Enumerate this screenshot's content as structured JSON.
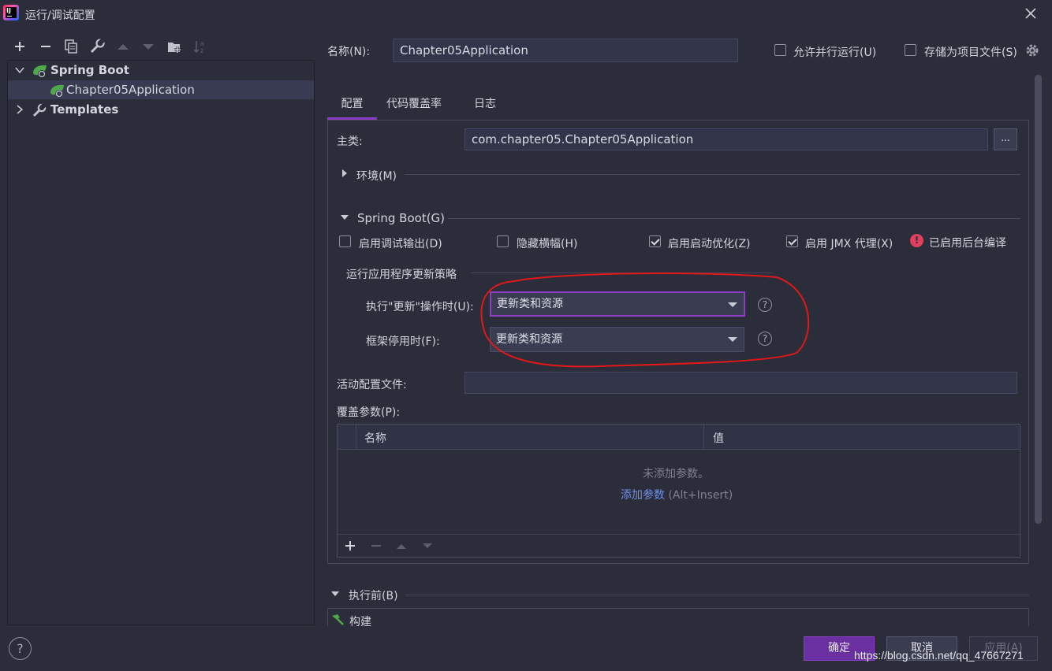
{
  "window": {
    "title": "运行/调试配置"
  },
  "tree": {
    "group": "Spring Boot",
    "item": "Chapter05Application",
    "templates": "Templates"
  },
  "header": {
    "name_label": "名称(N):",
    "name_value": "Chapter05Application",
    "allow_parallel": "允许并行运行(U)",
    "store_as_project_file": "存储为项目文件(S)"
  },
  "tabs": [
    "配置",
    "代码覆盖率",
    "日志"
  ],
  "config": {
    "main_class_label": "主类:",
    "main_class_value": "com.chapter05.Chapter05Application",
    "browse_button": "...",
    "env_section": "环境(M)",
    "spring_section": "Spring Boot(G)",
    "opt_debug_output": "启用调试输出(D)",
    "opt_hide_banner": "隐藏横幅(H)",
    "opt_launch_optimization": "启用启动优化(Z)",
    "opt_jmx": "启用 JMX 代理(X)",
    "background_compile": "已启用后台编译",
    "update_policy_title": "运行应用程序更新策略",
    "on_update_label": "执行\"更新\"操作时(U):",
    "on_update_value": "更新类和资源",
    "on_frame_label": "框架停用时(F):",
    "on_frame_value": "更新类和资源",
    "active_profiles_label": "活动配置文件:",
    "active_profiles_value": "",
    "override_params_label": "覆盖参数(P):",
    "table": {
      "col_name": "名称",
      "col_value": "值",
      "empty_text": "未添加参数。",
      "add_link": "添加参数",
      "add_shortcut": "(Alt+Insert)"
    }
  },
  "before_launch": {
    "section": "执行前(B)",
    "item": "构建"
  },
  "buttons": {
    "ok": "确定",
    "cancel": "取消",
    "apply": "应用(A)"
  },
  "watermark": "https://blog.csdn.net/qq_47667271",
  "colors": {
    "accent": "#8c3fc4",
    "highlight": "#e01818",
    "link": "#6f8fe8",
    "error": "#e0405e"
  }
}
